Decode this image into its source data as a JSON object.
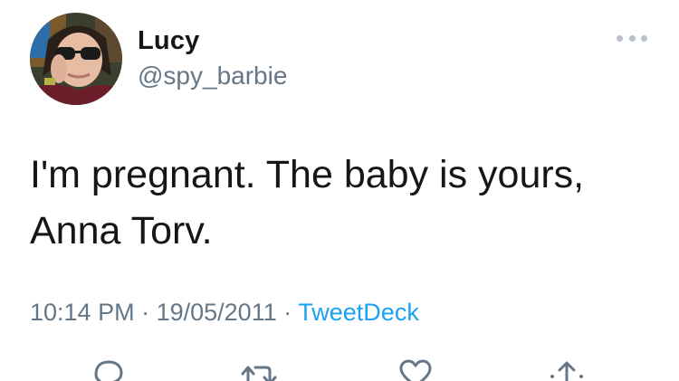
{
  "author": {
    "name": "Lucy",
    "handle": "@spy_barbie",
    "avatar_icon": "profile-photo"
  },
  "tweet": {
    "text_line1": "I'm pregnant. The baby is yours,",
    "text_line2": "Anna Torv.",
    "time": "10:14 PM",
    "separator": "·",
    "date": "19/05/2011",
    "source": "TweetDeck"
  },
  "menu": {
    "icon": "more-options-icon"
  },
  "actions": {
    "reply_icon": "reply-icon",
    "retweet_icon": "retweet-icon",
    "like_icon": "like-icon",
    "share_icon": "share-icon"
  },
  "colors": {
    "text": "#14171a",
    "secondary": "#657786",
    "accent": "#1da1f2",
    "icon": "#657786"
  }
}
